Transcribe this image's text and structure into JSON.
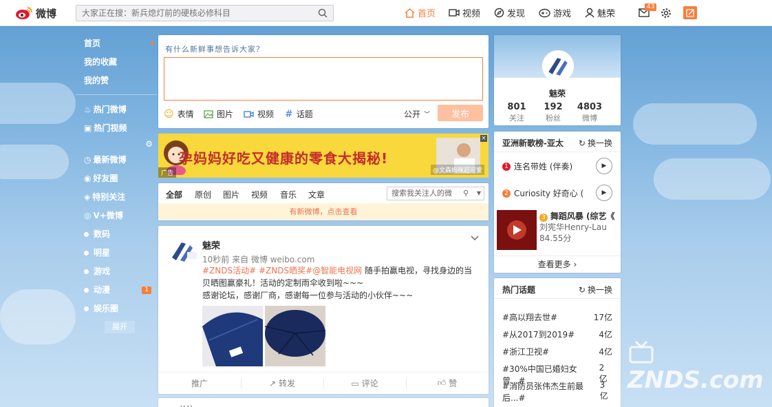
{
  "header": {
    "logo_text": "微博",
    "search_placeholder": "大家正在搜：新兵熄灯前的硬核必修科目",
    "nav": [
      {
        "label": "首页",
        "icon": "home-icon",
        "active": true
      },
      {
        "label": "视频",
        "icon": "video-icon"
      },
      {
        "label": "发现",
        "icon": "discover-icon"
      },
      {
        "label": "游戏",
        "icon": "game-icon"
      },
      {
        "label": "魅荣",
        "icon": "user-icon"
      }
    ],
    "message_badge": "43",
    "accent_color": "#fa7d3c"
  },
  "sidebar": {
    "top_items": [
      "首页",
      "我的收藏",
      "我的赞"
    ],
    "groups": [
      "热门微博",
      "热门视频",
      "最新微博",
      "好友圈",
      "特别关注",
      "V+微博"
    ],
    "tags": [
      "数码",
      "明星",
      "游戏",
      "动漫",
      "娱乐圈"
    ],
    "anime_badge": "1",
    "expand_label": "展开"
  },
  "publisher": {
    "prompt": "有什么新鲜事想告诉大家？",
    "tools": [
      "表情",
      "图片",
      "视频",
      "话题"
    ],
    "visibility": "公开",
    "submit_label": "发布"
  },
  "banner": {
    "headline": "孕妈妈好吃又健康的零食大揭秘!",
    "ad_tag": "广告",
    "watermark": "@文森妈咪超可爱"
  },
  "feed_tabs": {
    "tabs": [
      "全部",
      "原创",
      "图片",
      "视频",
      "音乐",
      "文章"
    ],
    "search_placeholder": "搜索我关注人的微",
    "new_notice": "有新微博，点击查看"
  },
  "post": {
    "author": "魅荣",
    "meta": "10秒前 来自 微博 weibo.com",
    "tags": "#ZNDS活动# #ZNDS晒奖#@智能电视网",
    "text1": " 随手拍赢电视，寻找身边的当贝晒图赢豪礼！活动的定制雨伞收到啦~~~",
    "text2": "感谢论坛，感谢厂商，感谢每一位参与活动的小伙伴~~~",
    "actions": [
      "推广",
      "转发",
      "评论",
      "赞"
    ],
    "next_preview": "关注"
  },
  "profile": {
    "name": "魅荣",
    "stats": [
      {
        "n": "801",
        "l": "关注"
      },
      {
        "n": "192",
        "l": "粉丝"
      },
      {
        "n": "4803",
        "l": "微博"
      }
    ]
  },
  "music": {
    "title": "亚洲新歌榜-亚太",
    "refresh": "换一换",
    "songs": [
      {
        "rank": "1",
        "name": "连名带姓 (伴奏)"
      },
      {
        "rank": "2",
        "name": "Curiosity 好奇心 ("
      },
      {
        "rank": "3",
        "name": "舞蹈风暴 (综艺《",
        "artist": "刘宪华Henry-Lau",
        "score": "84.55分"
      }
    ],
    "more": "查看更多"
  },
  "topics": {
    "title": "热门话题",
    "refresh": "换一换",
    "items": [
      {
        "t": "#高以翔去世#",
        "c": "17亿"
      },
      {
        "t": "#从2017到2019#",
        "c": "4亿"
      },
      {
        "t": "#浙江卫视#",
        "c": "4亿"
      },
      {
        "t": "#30%中国已婚妇女曾...#",
        "c": "2亿"
      },
      {
        "t": "#消防员张伟杰生前最后...#",
        "c": "3亿"
      }
    ]
  },
  "watermark": "ZNDS.com"
}
